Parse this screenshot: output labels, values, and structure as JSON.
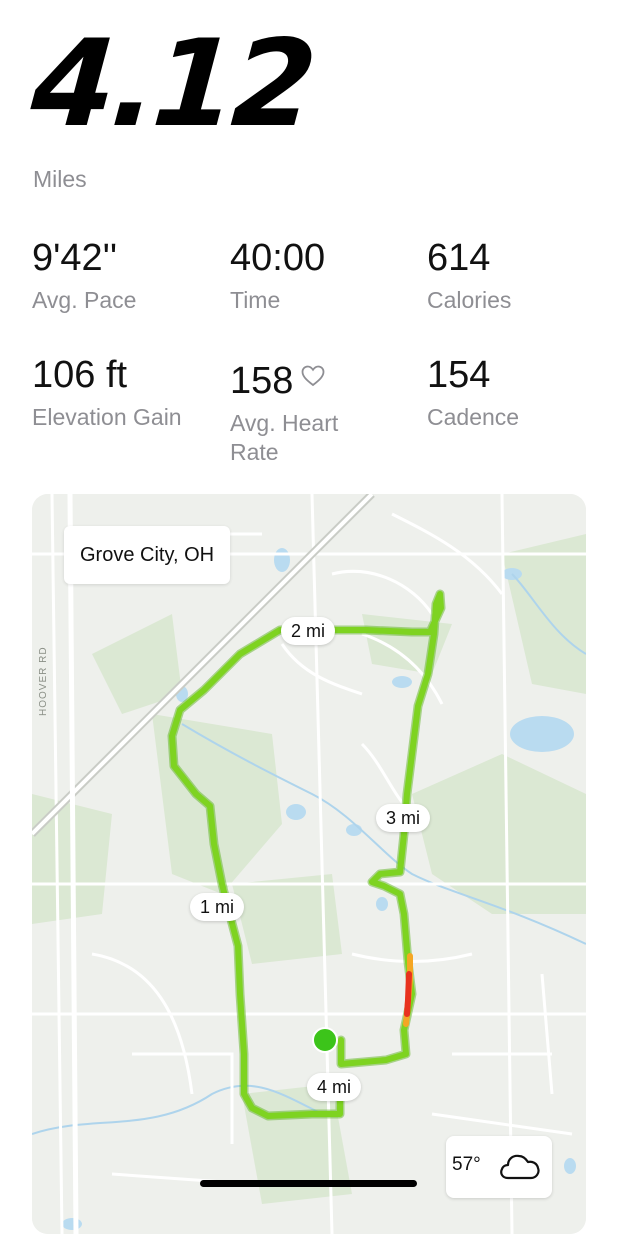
{
  "summary": {
    "distance": "4.12",
    "distance_unit": "Miles"
  },
  "stats": [
    {
      "value": "9'42''",
      "label": "Avg. Pace"
    },
    {
      "value": "40:00",
      "label": "Time"
    },
    {
      "value": "614",
      "label": "Calories"
    },
    {
      "value": "106 ft",
      "label": "Elevation Gain"
    },
    {
      "value": "158",
      "label": "Avg. Heart Rate",
      "icon": "heart-outline-icon"
    },
    {
      "value": "154",
      "label": "Cadence"
    }
  ],
  "map": {
    "location": "Grove City, OH",
    "road_label": "HOOVER RD",
    "mile_markers": [
      "1 mi",
      "2 mi",
      "3 mi",
      "4 mi"
    ],
    "weather": {
      "temperature": "57°",
      "icon": "cloud-icon"
    },
    "route_colors": {
      "main": "#7ed321",
      "fast": "#e8321e",
      "mid": "#f5a623",
      "start": "#3cc41a"
    }
  }
}
